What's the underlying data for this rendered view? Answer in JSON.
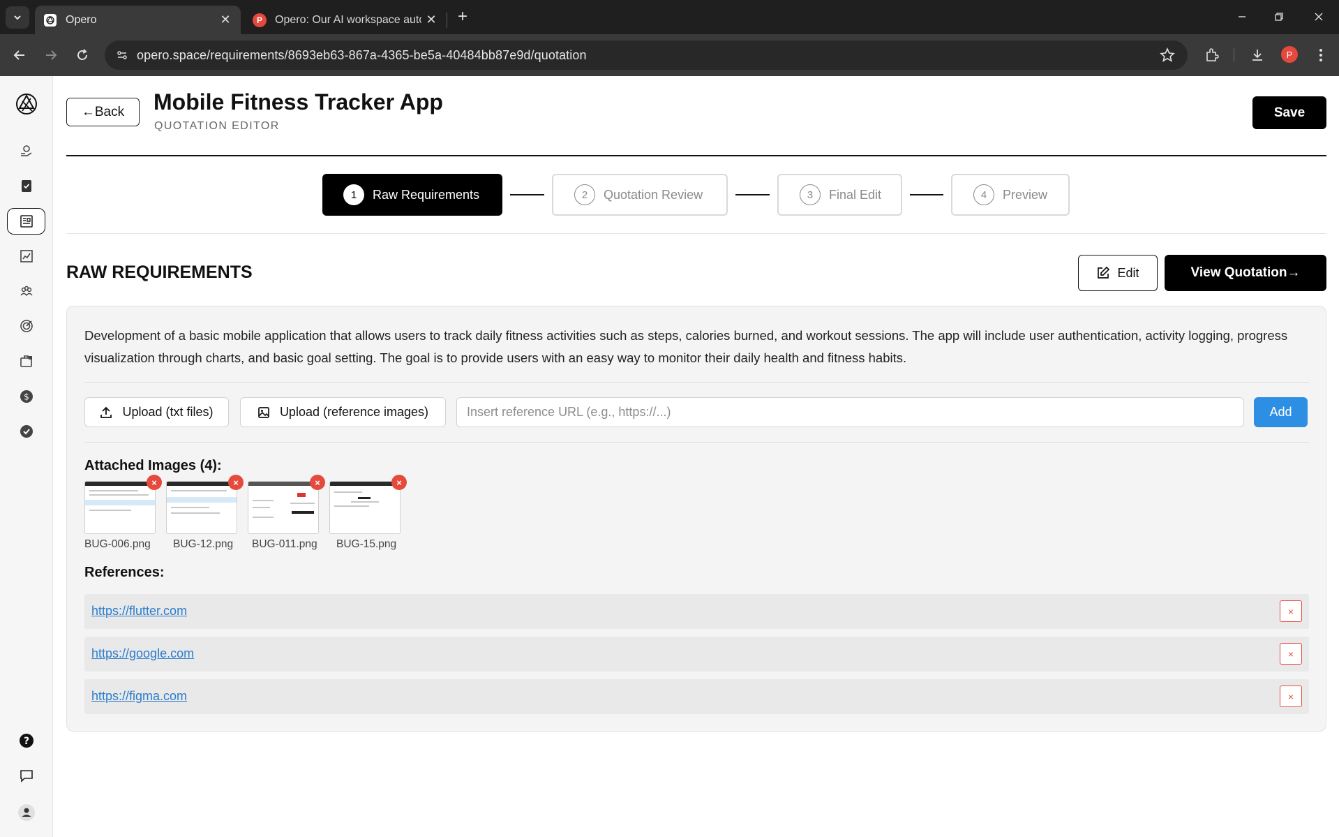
{
  "browser": {
    "tabs": [
      {
        "title": "Opero",
        "active": true
      },
      {
        "title": "Opero: Our AI workspace autom",
        "active": false
      }
    ],
    "url": "opero.space/requirements/8693eb63-867a-4365-be5a-40484bb87e9d/quotation",
    "profile_initial": "P",
    "favicon_initial": "P"
  },
  "header": {
    "back_label": "←Back",
    "title": "Mobile Fitness Tracker App",
    "subtitle": "QUOTATION EDITOR",
    "save_label": "Save"
  },
  "steps": [
    {
      "num": "1",
      "label": "Raw Requirements",
      "active": true
    },
    {
      "num": "2",
      "label": "Quotation Review",
      "active": false
    },
    {
      "num": "3",
      "label": "Final Edit",
      "active": false
    },
    {
      "num": "4",
      "label": "Preview",
      "active": false
    }
  ],
  "section": {
    "title": "RAW REQUIREMENTS",
    "edit_label": "Edit",
    "view_label": "View Quotation→"
  },
  "requirements": {
    "description": "Development of a basic mobile application that allows users to track daily fitness activities such as steps, calories burned, and workout sessions. The app will include user authentication, activity logging, progress visualization through charts, and basic goal setting. The goal is to provide users with an easy way to monitor their daily health and fitness habits.",
    "upload_txt_label": "Upload (txt files)",
    "upload_images_label": "Upload (reference images)",
    "url_placeholder": "Insert reference URL (e.g., https://...)",
    "add_label": "Add",
    "attached_title": "Attached Images (4):",
    "images": [
      "BUG-006.png",
      "BUG-12.png",
      "BUG-011.png",
      "BUG-15.png"
    ],
    "references_title": "References:",
    "references": [
      "https://flutter.com",
      "https://google.com",
      "https://figma.com"
    ],
    "remove_symbol": "×"
  },
  "colors": {
    "accent_blue": "#2d8fe3",
    "remove_red": "#e64a3c",
    "primary_black": "#000000"
  },
  "icons": {
    "sidebar": [
      "gear-hand-icon",
      "clipboard-check-icon",
      "document-list-icon",
      "chart-board-icon",
      "team-icon",
      "target-icon",
      "briefcase-icon",
      "dollar-icon",
      "check-circle-icon"
    ],
    "sidebar_bottom": [
      "help-icon",
      "chat-icon",
      "user-icon"
    ]
  }
}
